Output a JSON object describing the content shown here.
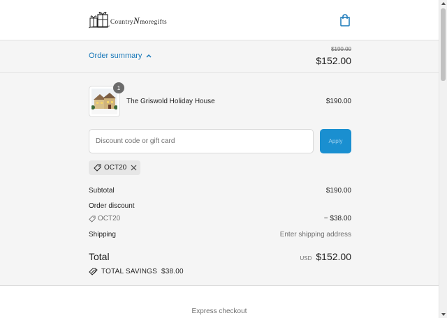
{
  "header": {
    "logo": {
      "big_letter": "N",
      "text_left": "Country",
      "text_right": "moregifts",
      "icon": "gift-boxes-icon"
    },
    "cart_icon": "shopping-bag-icon"
  },
  "summary": {
    "toggle_label": "Order summary",
    "toggle_icon": "chevron-up-icon",
    "compare_at": "$190.00",
    "total": "$152.00"
  },
  "cart": {
    "items": [
      {
        "name": "The Griswold Holiday House",
        "price": "$190.00",
        "quantity": "1"
      }
    ]
  },
  "discount": {
    "placeholder": "Discount code or gift card",
    "apply_label": "Apply",
    "applied_code": "OCT20"
  },
  "totals": {
    "subtotal_label": "Subtotal",
    "subtotal_value": "$190.00",
    "order_discount_label": "Order discount",
    "discount_code": "OCT20",
    "discount_value": "− $38.00",
    "shipping_label": "Shipping",
    "shipping_value": "Enter shipping address",
    "total_label": "Total",
    "currency": "USD",
    "total_value": "$152.00",
    "savings_label": "TOTAL SAVINGS",
    "savings_value": "$38.00"
  },
  "express": {
    "label": "Express checkout"
  },
  "colors": {
    "accent": "#1878b9",
    "apply_button": "#1a8fd0",
    "panel_bg": "#f5f5f5"
  }
}
